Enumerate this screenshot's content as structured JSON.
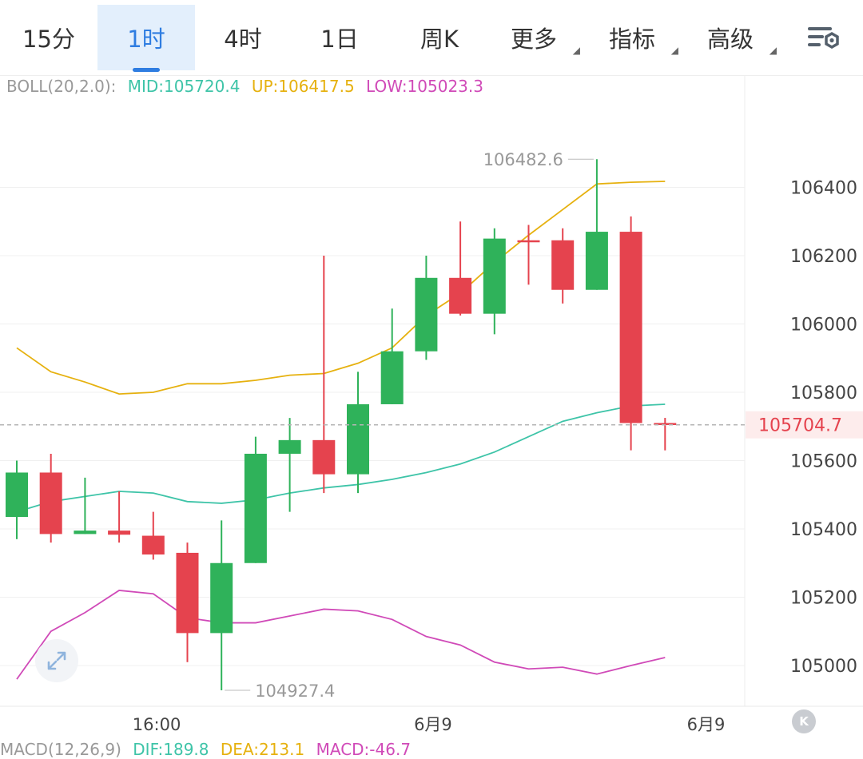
{
  "tabs": [
    {
      "label": "15分",
      "active": false,
      "dropdown": false
    },
    {
      "label": "1时",
      "active": true,
      "dropdown": false
    },
    {
      "label": "4时",
      "active": false,
      "dropdown": false
    },
    {
      "label": "1日",
      "active": false,
      "dropdown": false
    },
    {
      "label": "周K",
      "active": false,
      "dropdown": false
    },
    {
      "label": "更多",
      "active": false,
      "dropdown": true
    },
    {
      "label": "指标",
      "active": false,
      "dropdown": true
    },
    {
      "label": "高级",
      "active": false,
      "dropdown": true
    }
  ],
  "settings_icon": "chart-settings-icon",
  "indicator_header": {
    "name": "BOLL(20,2.0):",
    "mid": "MID:105720.4",
    "up": "UP:106417.5",
    "low": "LOW:105023.3"
  },
  "macd_header": {
    "name": "MACD(12,26,9)",
    "dif": "DIF:189.8",
    "dea": "DEA:213.1",
    "macd": "MACD:-46.7"
  },
  "colors": {
    "up": "#2fb25a",
    "down": "#e5434e",
    "mid": "#3ec4a8",
    "upper": "#e6b10f",
    "lower": "#d04ab8",
    "active_tab": "#2f7de1",
    "price_tag_bg": "#fdecec",
    "price_tag_text": "#e5434e"
  },
  "chart_data": {
    "type": "candlestick",
    "ylim": [
      104900,
      106600
    ],
    "y_ticks": [
      105000,
      105200,
      105400,
      105600,
      105800,
      106000,
      106200,
      106400
    ],
    "x_tick_labels": [
      {
        "label": "16:00",
        "at_index": 4.1
      },
      {
        "label": "6月9",
        "at_index": 12.2
      },
      {
        "label": "6月9",
        "at_index": 20.2
      }
    ],
    "candles": [
      {
        "o": 105435,
        "h": 105600,
        "l": 105370,
        "c": 105565
      },
      {
        "o": 105565,
        "h": 105620,
        "l": 105360,
        "c": 105385
      },
      {
        "o": 105385,
        "h": 105550,
        "l": 105385,
        "c": 105395
      },
      {
        "o": 105395,
        "h": 105510,
        "l": 105360,
        "c": 105383
      },
      {
        "o": 105380,
        "h": 105450,
        "l": 105310,
        "c": 105325
      },
      {
        "o": 105330,
        "h": 105360,
        "l": 105010,
        "c": 105095
      },
      {
        "o": 105095,
        "h": 105425,
        "l": 104927.4,
        "c": 105300
      },
      {
        "o": 105300,
        "h": 105670,
        "l": 105300,
        "c": 105620
      },
      {
        "o": 105620,
        "h": 105725,
        "l": 105450,
        "c": 105660
      },
      {
        "o": 105660,
        "h": 106200,
        "l": 105505,
        "c": 105560
      },
      {
        "o": 105560,
        "h": 105860,
        "l": 105505,
        "c": 105765
      },
      {
        "o": 105765,
        "h": 106045,
        "l": 105765,
        "c": 105920
      },
      {
        "o": 105920,
        "h": 106200,
        "l": 105895,
        "c": 106135
      },
      {
        "o": 106135,
        "h": 106300,
        "l": 106025,
        "c": 106030
      },
      {
        "o": 106030,
        "h": 106280,
        "l": 105970,
        "c": 106250
      },
      {
        "o": 106245,
        "h": 106290,
        "l": 106115,
        "c": 106240
      },
      {
        "o": 106245,
        "h": 106280,
        "l": 106060,
        "c": 106100
      },
      {
        "o": 106100,
        "h": 106482.6,
        "l": 106100,
        "c": 106270
      },
      {
        "o": 106270,
        "h": 106315,
        "l": 105630,
        "c": 105710
      },
      {
        "o": 105710,
        "h": 105725,
        "l": 105630,
        "c": 105704.7
      }
    ],
    "boll_mid": [
      105450,
      105480,
      105495,
      105510,
      105505,
      105480,
      105475,
      105485,
      105505,
      105520,
      105530,
      105545,
      105565,
      105590,
      105625,
      105670,
      105715,
      105740,
      105760,
      105765
    ],
    "boll_upper": [
      105930,
      105860,
      105830,
      105795,
      105800,
      105825,
      105825,
      105835,
      105850,
      105855,
      105885,
      105930,
      106025,
      106090,
      106180,
      106260,
      106335,
      106410,
      106415,
      106417.5
    ],
    "boll_lower": [
      104960,
      105100,
      105155,
      105220,
      105210,
      105140,
      105125,
      105125,
      105145,
      105165,
      105160,
      105135,
      105085,
      105060,
      105010,
      104990,
      104995,
      104975,
      105000,
      105023.3
    ],
    "high_marker": {
      "label": "106482.6",
      "value": 106482.6,
      "at_index": 17
    },
    "low_marker": {
      "label": "104927.4",
      "value": 104927.4,
      "at_index": 6
    },
    "last_price": {
      "label": "105704.7",
      "value": 105704.7
    }
  }
}
